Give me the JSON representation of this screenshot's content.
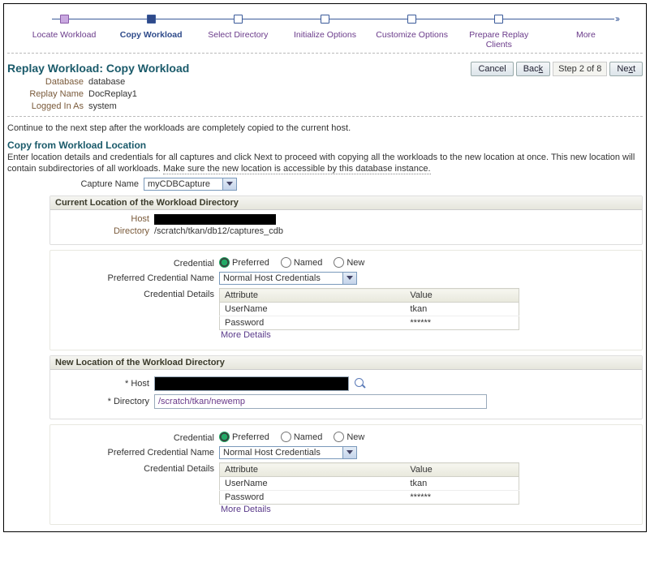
{
  "stepper": {
    "items": [
      {
        "label": "Locate Workload",
        "state": "done"
      },
      {
        "label": "Copy Workload",
        "state": "active"
      },
      {
        "label": "Select Directory",
        "state": ""
      },
      {
        "label": "Initialize Options",
        "state": ""
      },
      {
        "label": "Customize Options",
        "state": ""
      },
      {
        "label": "Prepare Replay Clients",
        "state": ""
      },
      {
        "label": "More",
        "state": ""
      }
    ]
  },
  "page": {
    "title": "Replay Workload: Copy Workload",
    "database_label": "Database",
    "database": "database",
    "replay_name_label": "Replay Name",
    "replay_name": "DocReplay1",
    "logged_in_label": "Logged In As",
    "logged_in": "system",
    "cancel": "Cancel",
    "back_html": "Back",
    "step_of": "Step 2 of 8",
    "next_html": "Next",
    "instruction": "Continue to the next step after the workloads are completely copied to the current host."
  },
  "copy_from": {
    "title": "Copy from Workload Location",
    "sub_pre": "Enter location details and credentials for all captures and click Next to proceed with copying all the workloads to the new location at once. This new location will contain subdirectories of all workloads. ",
    "sub_u": "Make sure the new location is accessible by this database instance.",
    "capture_name_label": "Capture Name",
    "capture_name": "myCDBCapture"
  },
  "current": {
    "title": "Current Location of the Workload Directory",
    "host_label": "Host",
    "directory_label": "Directory",
    "directory": "/scratch/tkan/db12/captures_cdb",
    "credential_label": "Credential",
    "preferred": "Preferred",
    "named": "Named",
    "new": "New",
    "pref_cred_name_label": "Preferred Credential Name",
    "pref_cred_name": "Normal Host Credentials",
    "cred_details_label": "Credential Details",
    "attr": "Attribute",
    "val": "Value",
    "user_k": "UserName",
    "user_v": "tkan",
    "pass_k": "Password",
    "pass_v": "******",
    "more": "More Details"
  },
  "newloc": {
    "title": "New Location of the Workload Directory",
    "host_label": "* Host",
    "dir_label": "* Directory",
    "dir": "/scratch/tkan/newemp",
    "credential_label": "Credential",
    "preferred": "Preferred",
    "named": "Named",
    "new": "New",
    "pref_cred_name_label": "Preferred Credential Name",
    "pref_cred_name": "Normal Host Credentials",
    "cred_details_label": "Credential Details",
    "attr": "Attribute",
    "val": "Value",
    "user_k": "UserName",
    "user_v": "tkan",
    "pass_k": "Password",
    "pass_v": "******",
    "more": "More Details"
  }
}
